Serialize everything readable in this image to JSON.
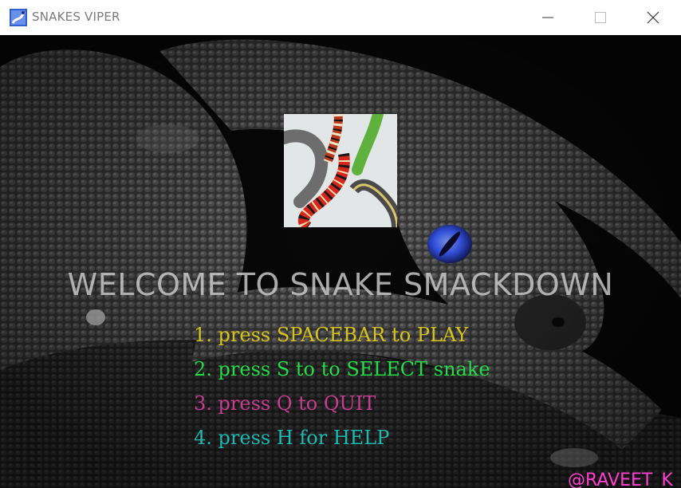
{
  "window": {
    "title": "SNAKES VIPER",
    "icon": "snake-app-icon",
    "controls": {
      "minimize": "minimize-icon",
      "maximize": "maximize-icon",
      "close": "close-icon"
    }
  },
  "game": {
    "headline": "WELCOME TO SNAKE SMACKDOWN",
    "menu": [
      {
        "text": "1. press SPACEBAR to PLAY",
        "color": "#d8c21c"
      },
      {
        "text": "2. press S to to SELECT snake",
        "color": "#23dd47"
      },
      {
        "text": "3. press Q to QUIT",
        "color": "#c73d92"
      },
      {
        "text": "4. press H for HELP",
        "color": "#1dbab2"
      }
    ],
    "credit": "@RAVEET_K",
    "accent_eye_color": "#3a5cff"
  }
}
